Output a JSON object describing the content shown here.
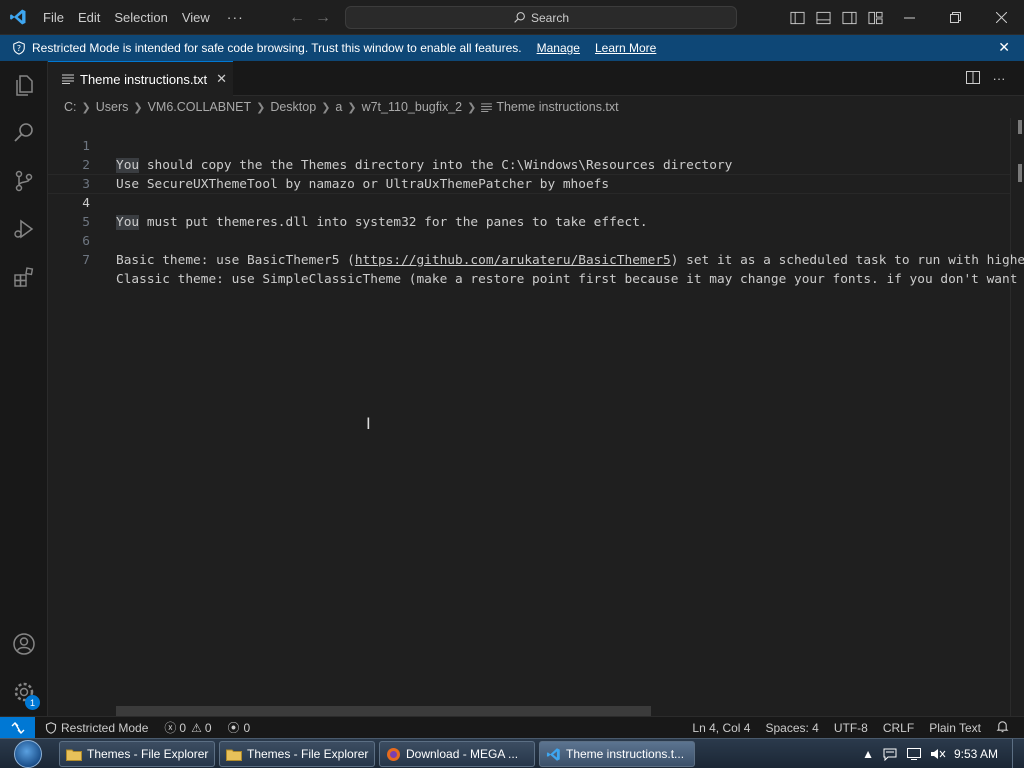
{
  "titlebar": {
    "menu": [
      "File",
      "Edit",
      "Selection",
      "View"
    ],
    "more": "···",
    "search_placeholder": "Search"
  },
  "banner": {
    "message": "Restricted Mode is intended for safe code browsing. Trust this window to enable all features.",
    "manage": "Manage",
    "learn_more": "Learn More"
  },
  "tab": {
    "label": "Theme instructions.txt"
  },
  "breadcrumb": [
    "C:",
    "Users",
    "VM6.COLLABNET",
    "Desktop",
    "a",
    "w7t_110_bugfix_2",
    "Theme instructions.txt"
  ],
  "editor": {
    "lines": [
      {
        "num": "1",
        "pre": "You",
        "text": " should copy the the Themes directory into the C:\\Windows\\Resources directory"
      },
      {
        "num": "2",
        "pre": "",
        "text": "Use SecureUXThemeTool by namazo or UltraUxThemePatcher by mhoefs"
      },
      {
        "num": "3",
        "pre": "",
        "text": ""
      },
      {
        "num": "4",
        "pre": "You",
        "text": " must put themeres.dll into system32 for the panes to take effect."
      },
      {
        "num": "5",
        "pre": "",
        "text": ""
      },
      {
        "num": "6",
        "pre": "Basic theme: use BasicThemer5 (",
        "link": "https://github.com/arukateru/BasicThemer5",
        "text": ") set it as a scheduled task to run with highe"
      },
      {
        "num": "7",
        "pre": "",
        "text": "Classic theme: use SimpleClassicTheme (make a restore point first because it may change your fonts. if you don't want"
      }
    ]
  },
  "statusbar": {
    "restricted": "Restricted Mode",
    "errors": "0",
    "warnings": "0",
    "ports": "0",
    "position": "Ln 4, Col 4",
    "spaces": "Spaces: 4",
    "encoding": "UTF-8",
    "eol": "CRLF",
    "language": "Plain Text"
  },
  "taskbar": {
    "tasks": [
      "Themes - File Explorer",
      "Themes - File Explorer",
      "Download - MEGA ...",
      "Theme instructions.t..."
    ],
    "time": "9:53 AM"
  },
  "colors": {
    "accent": "#0078d4",
    "banner": "#0e4776",
    "editor_bg": "#1f1f1f"
  }
}
